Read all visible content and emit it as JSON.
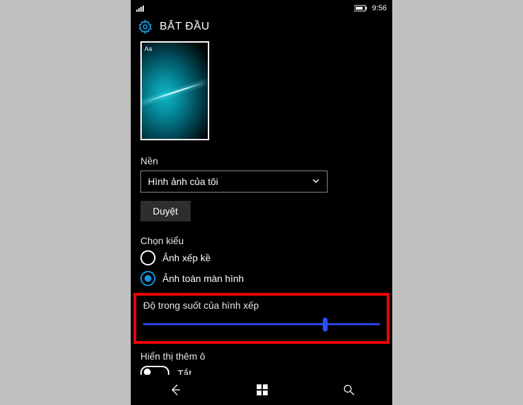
{
  "status": {
    "time": "9:56"
  },
  "header": {
    "title": "BẮT ĐẦU"
  },
  "preview": {
    "sample_text": "Aa"
  },
  "background": {
    "label": "Nền",
    "selected": "Hình ảnh của tôi",
    "browse_label": "Duyệt"
  },
  "style": {
    "label": "Chọn kiểu",
    "options": [
      {
        "label": "Ảnh xếp kề",
        "selected": false
      },
      {
        "label": "Ảnh toàn màn hình",
        "selected": true
      }
    ]
  },
  "transparency": {
    "label": "Độ trong suốt của hình xếp",
    "value": 76
  },
  "showMore": {
    "label": "Hiển thị thêm ô",
    "state_label": "Tắt",
    "on": false
  }
}
